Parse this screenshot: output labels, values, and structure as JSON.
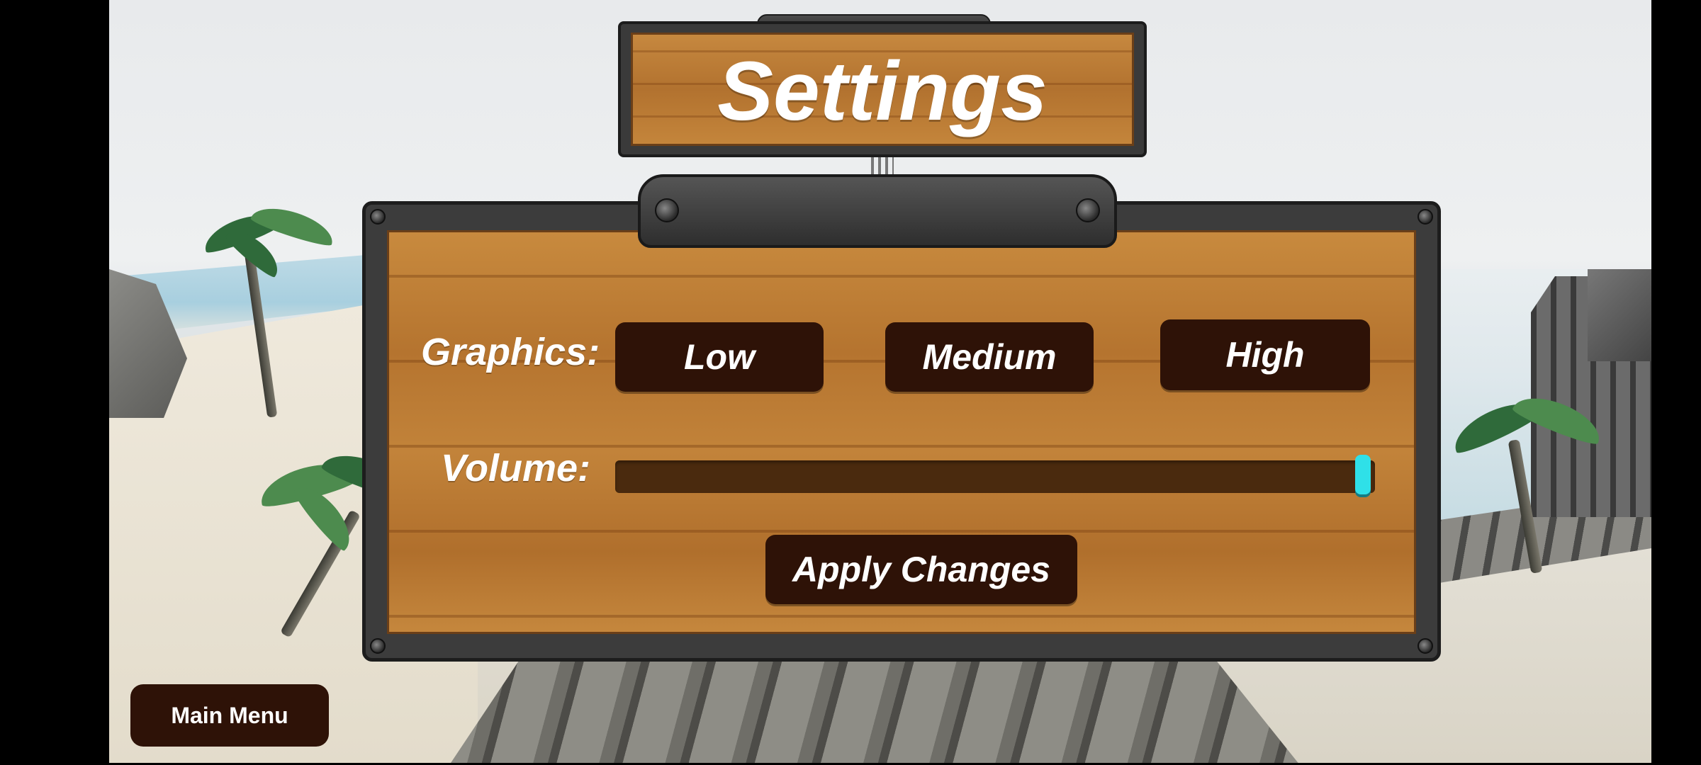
{
  "title": "Settings",
  "graphics": {
    "label": "Graphics:",
    "options": [
      "Low",
      "Medium",
      "High"
    ]
  },
  "volume": {
    "label": "Volume:",
    "level_percent": 100
  },
  "apply_label": "Apply Changes",
  "main_menu_label": "Main Menu",
  "colors": {
    "wood": "#c2833a",
    "button": "#2e1207",
    "slider_thumb": "#2fe0e8"
  }
}
